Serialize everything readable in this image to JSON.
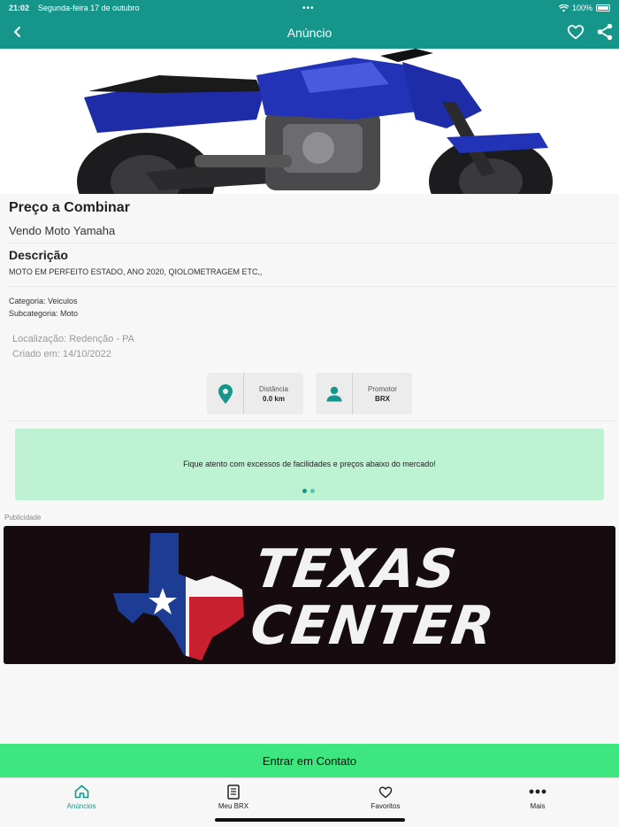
{
  "status_bar": {
    "time": "21:02",
    "date": "Segunda-feira 17 de outubro",
    "battery": "100%"
  },
  "header": {
    "title": "Anúncio"
  },
  "listing": {
    "price": "Preço a Combinar",
    "title": "Vendo Moto Yamaha",
    "description_heading": "Descrição",
    "description": "MOTO EM PERFEITO ESTADO, ANO 2020, QIOLOMETRAGEM ETC,,",
    "category": "Categoria: Veiculos",
    "subcategory": "Subcategoria: Moto",
    "location": "Localização: Redenção - PA",
    "created": "Criado em: 14/10/2022"
  },
  "info_cards": {
    "distance": {
      "label": "Distância",
      "value": "0.0 km",
      "icon": "map-pin-icon"
    },
    "promoter": {
      "label": "Promotor",
      "value": "BRX",
      "icon": "person-icon"
    }
  },
  "alert": {
    "message": "Fique atento com excessos de facilidades e preços abaixo do mercado!",
    "pages": 2,
    "active_page": 1
  },
  "ad": {
    "label": "Publicidade",
    "line1": "TEXAS",
    "line2": "CENTER"
  },
  "cta": {
    "label": "Entrar em Contato"
  },
  "tabs": [
    {
      "label": "Anúncios",
      "icon": "home-icon",
      "active": true
    },
    {
      "label": "Meu BRX",
      "icon": "document-icon",
      "active": false
    },
    {
      "label": "Favoritos",
      "icon": "heart-icon",
      "active": false
    },
    {
      "label": "Mais",
      "icon": "more-icon",
      "active": false
    }
  ],
  "colors": {
    "primary": "#16968a",
    "cta": "#3de67e",
    "alert_bg": "#bdf3d2",
    "motorcycle_blue": "#2233b8"
  }
}
